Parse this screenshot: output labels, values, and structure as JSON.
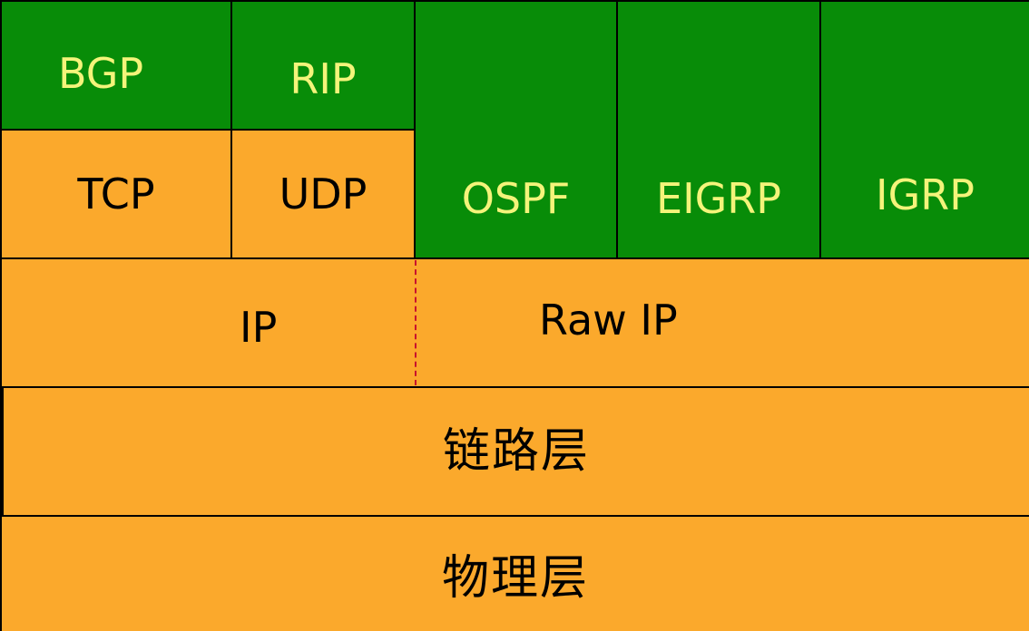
{
  "layers": {
    "routing": {
      "bgp": "BGP",
      "rip": "RIP",
      "ospf": "OSPF",
      "eigrp": "EIGRP",
      "igrp": "IGRP"
    },
    "transport": {
      "tcp": "TCP",
      "udp": "UDP"
    },
    "network": {
      "ip": "IP",
      "raw_ip": "Raw IP"
    },
    "link": "链路层",
    "physical": "物理层"
  },
  "colors": {
    "routing_fill": "#088c08",
    "routing_text": "#f4f47a",
    "layer_fill": "#fba92c",
    "layer_text": "#000000",
    "divider_dash": "#c8102e"
  }
}
